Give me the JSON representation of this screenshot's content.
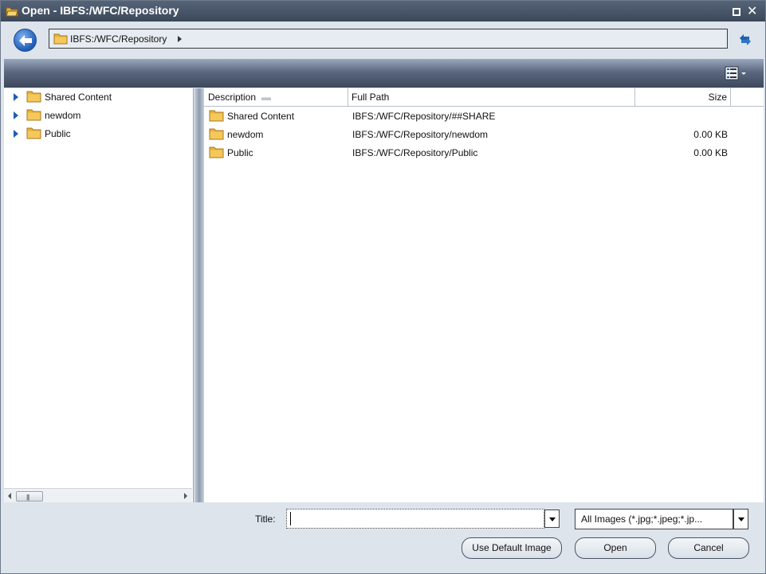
{
  "window": {
    "title": "Open - IBFS:/WFC/Repository",
    "app_icon": "open-folder-icon",
    "maximize_icon": "maximize-icon",
    "close_icon": "close-icon",
    "close_glyph": "✕"
  },
  "address": {
    "back_icon": "back-arrow-icon",
    "path": "IBFS:/WFC/Repository",
    "refresh_icon": "refresh-icon"
  },
  "toolbar": {
    "view_icon": "details-view-icon"
  },
  "tree": {
    "items": [
      {
        "label": "Shared Content"
      },
      {
        "label": "newdom"
      },
      {
        "label": "Public"
      }
    ],
    "scroll_thumb_glyph": "|||"
  },
  "list": {
    "columns": {
      "description": "Description",
      "full_path": "Full Path",
      "size": "Size"
    },
    "rows": [
      {
        "description": "Shared Content",
        "full_path": "IBFS:/WFC/Repository/##SHARE",
        "size": ""
      },
      {
        "description": "newdom",
        "full_path": "IBFS:/WFC/Repository/newdom",
        "size": "0.00 KB"
      },
      {
        "description": "Public",
        "full_path": "IBFS:/WFC/Repository/Public",
        "size": "0.00 KB"
      }
    ]
  },
  "bottom": {
    "title_label": "Title:",
    "title_value": "",
    "filter_value": "All Images (*.jpg;*.jpeg;*.jp...",
    "buttons": {
      "use_default": "Use Default Image",
      "open": "Open",
      "cancel": "Cancel"
    }
  },
  "colors": {
    "titlebar": "#3c4859",
    "folder": "#e8b23c",
    "expander": "#1e5fb0",
    "accent_blue": "#1e5cb5"
  }
}
